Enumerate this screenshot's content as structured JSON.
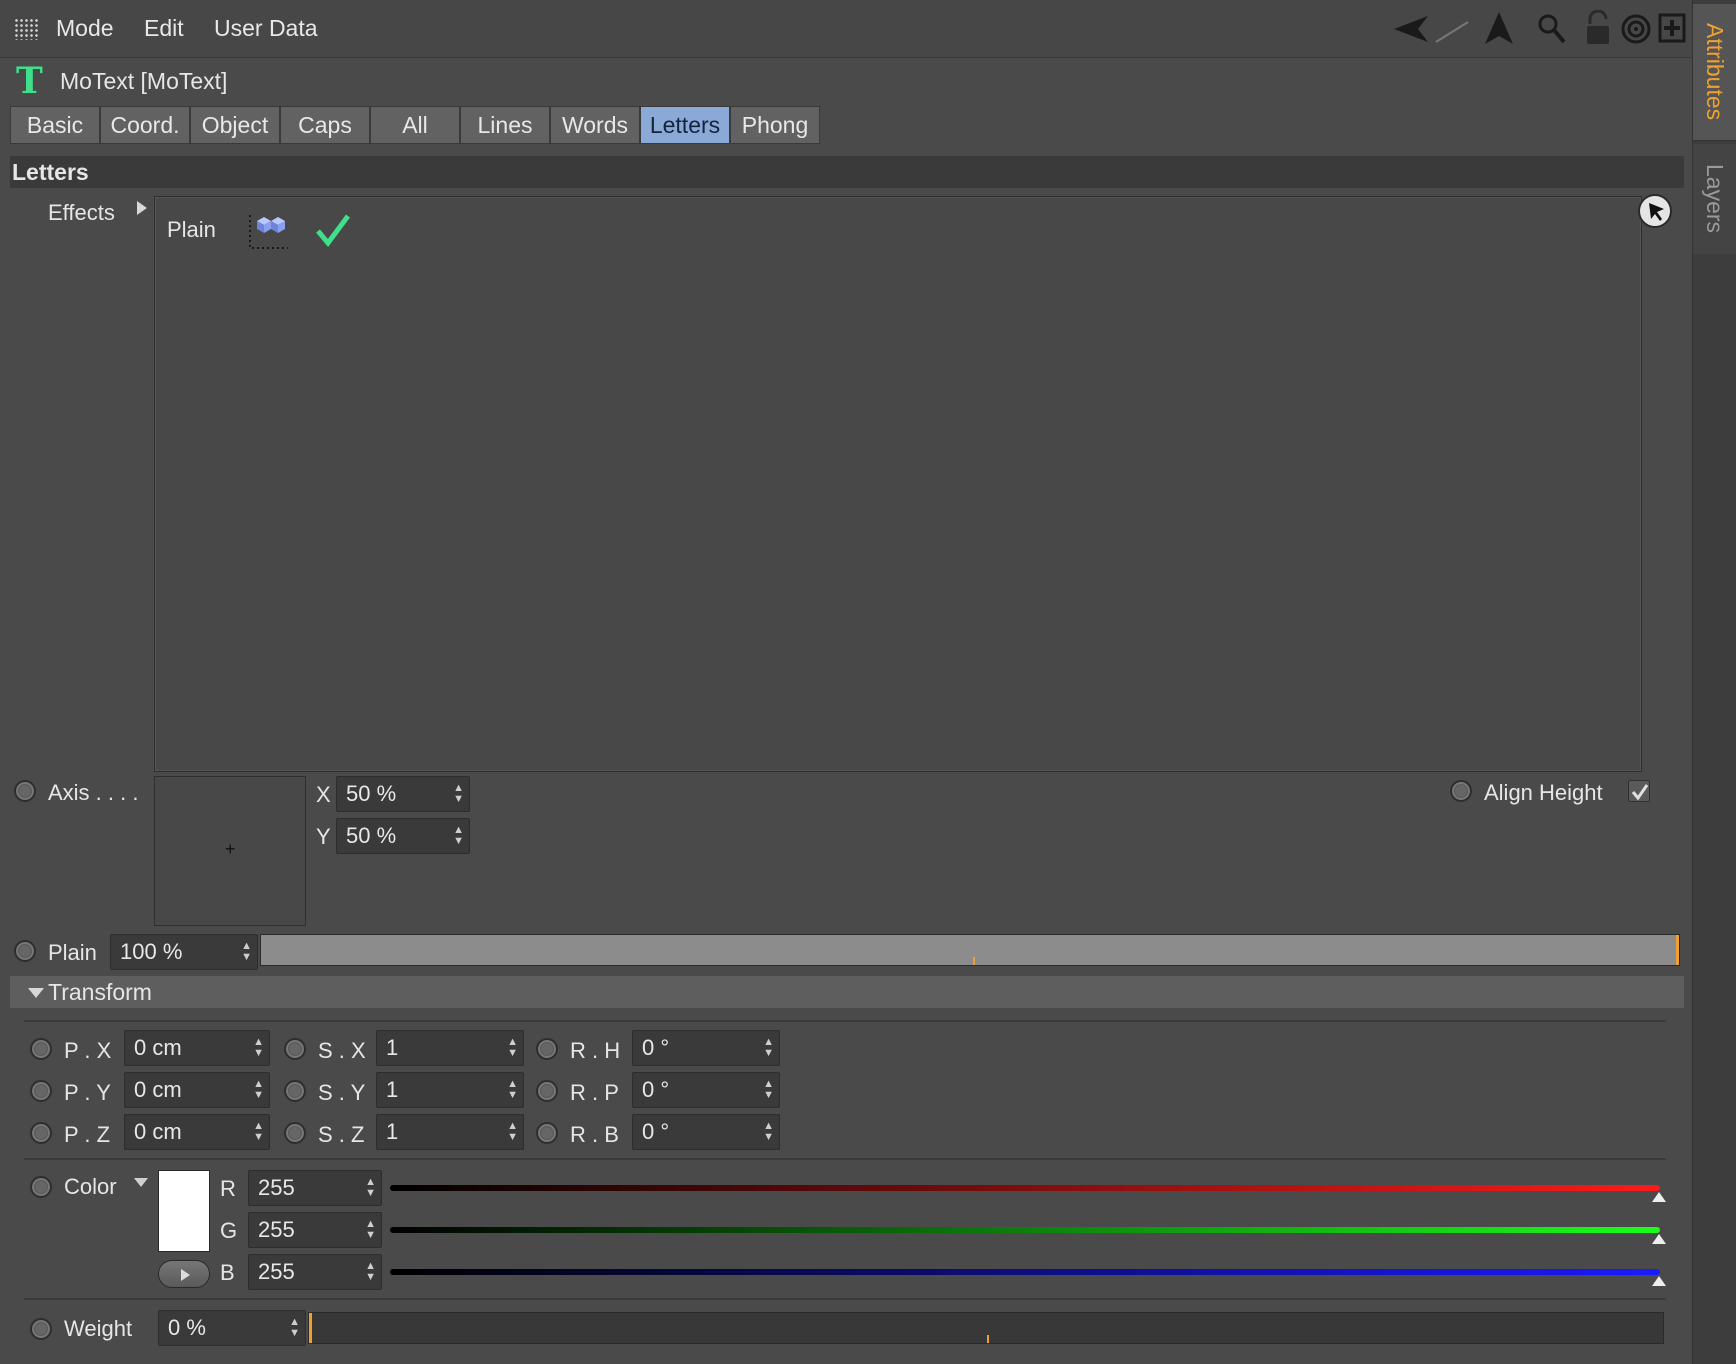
{
  "menubar": {
    "mode": "Mode",
    "edit": "Edit",
    "user_data": "User Data"
  },
  "sidetabs": {
    "attributes": "Attributes",
    "layers": "Layers"
  },
  "object": {
    "title": "MoText [MoText]",
    "icon_letter": "T"
  },
  "tabs": [
    "Basic",
    "Coord.",
    "Object",
    "Caps",
    "All",
    "Lines",
    "Words",
    "Letters",
    "Phong"
  ],
  "active_tab": "Letters",
  "section_title": "Letters",
  "effects": {
    "label": "Effects",
    "items": [
      {
        "name": "Plain",
        "enabled": true
      }
    ]
  },
  "axis": {
    "label": "Axis . . . .",
    "x_label": "X",
    "x_value": "50 %",
    "y_label": "Y",
    "y_value": "50 %"
  },
  "align_height": {
    "label": "Align Height",
    "checked": true
  },
  "plain": {
    "label": "Plain",
    "value": "100 %",
    "fraction": 1.0
  },
  "transform": {
    "title": "Transform",
    "rows": [
      {
        "p_label": "P . X",
        "p_value": "0 cm",
        "s_label": "S . X",
        "s_value": "1",
        "r_label": "R . H",
        "r_value": "0 °"
      },
      {
        "p_label": "P . Y",
        "p_value": "0 cm",
        "s_label": "S . Y",
        "s_value": "1",
        "r_label": "R . P",
        "r_value": "0 °"
      },
      {
        "p_label": "P . Z",
        "p_value": "0 cm",
        "s_label": "S . Z",
        "s_value": "1",
        "r_label": "R . B",
        "r_value": "0 °"
      }
    ]
  },
  "color": {
    "label": "Color",
    "swatch": "#ffffff",
    "r_label": "R",
    "r_value": "255",
    "g_label": "G",
    "g_value": "255",
    "b_label": "B",
    "b_value": "255"
  },
  "weight": {
    "label": "Weight",
    "value": "0 %",
    "fraction": 0.0
  },
  "colors": {
    "active_tab": "#8aa9d6",
    "accent_orange": "#f0a030",
    "check_green": "#3fe08a"
  }
}
